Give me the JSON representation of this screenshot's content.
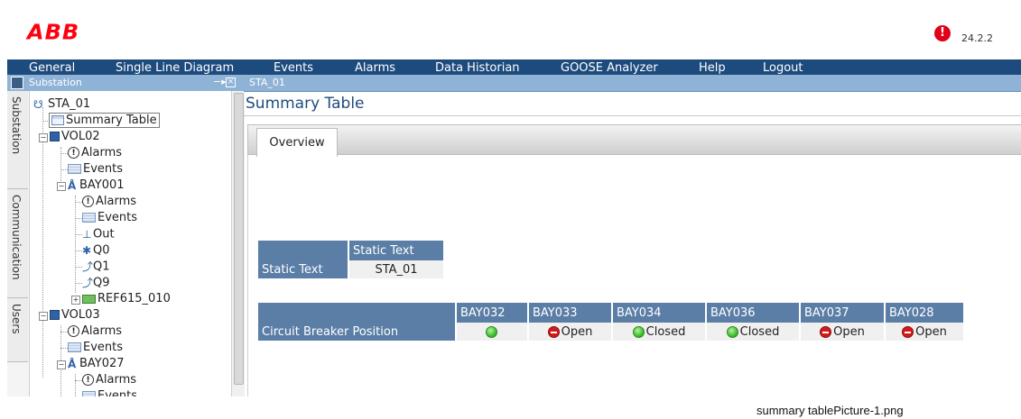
{
  "header": {
    "logo": "ABB",
    "alert_glyph": "!",
    "date": "24.2.2"
  },
  "menu": [
    "General",
    "Single Line Diagram",
    "Events",
    "Alarms",
    "Data Historian",
    "GOOSE Analyzer",
    "Help",
    "Logout"
  ],
  "left_panel": {
    "title": "Substation",
    "side_tabs": [
      "Substation",
      "Communication",
      "Users"
    ],
    "tree": {
      "root": "STA_01",
      "summary_table": "Summary Table",
      "vol02": "VOL02",
      "vol02_alarms": "Alarms",
      "vol02_events": "Events",
      "bay001": "BAY001",
      "bay001_alarms": "Alarms",
      "bay001_events": "Events",
      "out": "Out",
      "q0": "Q0",
      "q1": "Q1",
      "q9": "Q9",
      "ref615": "REF615_010",
      "vol03": "VOL03",
      "vol03_alarms": "Alarms",
      "vol03_events": "Events",
      "bay027": "BAY027",
      "bay027_alarms": "Alarms",
      "bay027_events": "Events"
    }
  },
  "main": {
    "tab_label": "STA_01",
    "page_title": "Summary Table",
    "content_tab": "Overview",
    "static_table": {
      "column_header": "Static Text",
      "row_header": "Static Text",
      "value": "STA_01"
    },
    "cb_table": {
      "row_header": "Circuit Breaker Position",
      "columns": [
        "BAY032",
        "BAY033",
        "BAY034",
        "BAY036",
        "BAY037",
        "BAY028"
      ],
      "values": [
        "",
        "Open",
        "Closed",
        "Closed",
        "Open",
        "Open"
      ],
      "indicators": [
        "green",
        "red",
        "green",
        "green",
        "red",
        "red"
      ]
    }
  },
  "caption": "summary tablePicture-1.png",
  "colors": {
    "menu_bg": "#1e4b7d",
    "header_cell": "#5a7ea6",
    "logo": "#ff000f",
    "open": "#d21a1a",
    "closed": "#3fbf2e"
  }
}
